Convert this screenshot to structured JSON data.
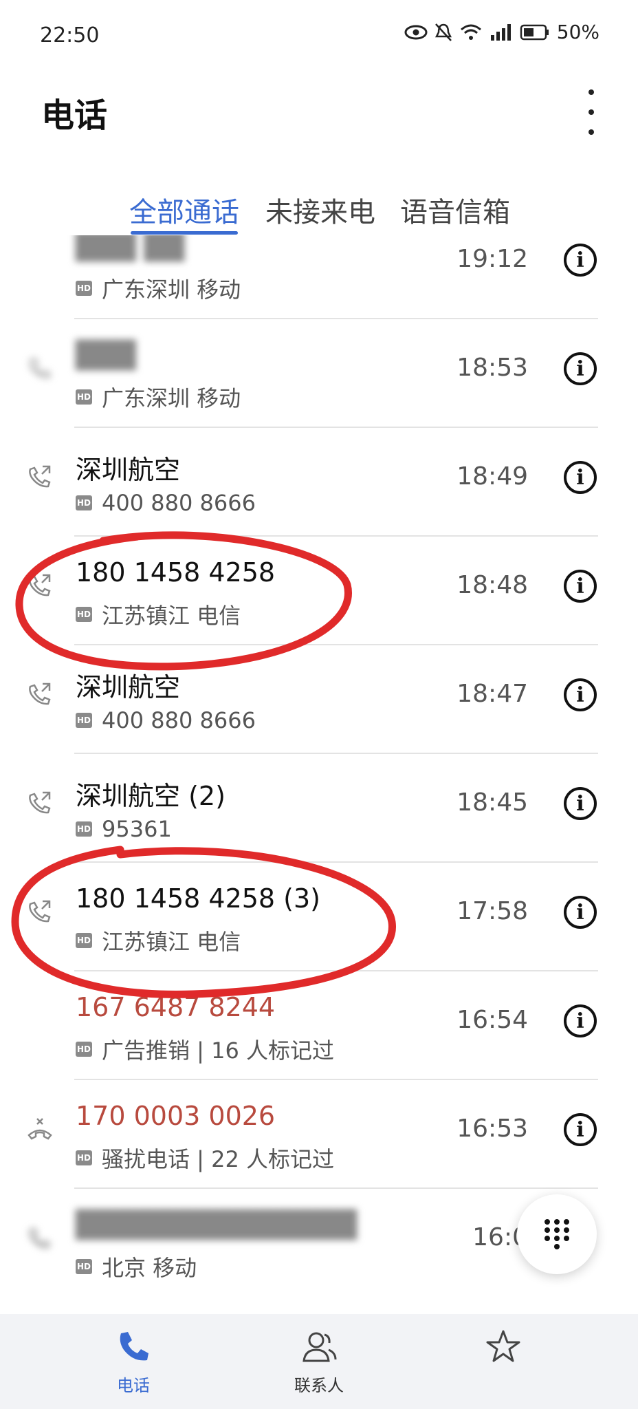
{
  "status_bar": {
    "time": "22:50",
    "battery": "50%",
    "icons": [
      "eye-icon",
      "mute-bell-icon",
      "wifi-icon",
      "signal-icon",
      "battery-icon"
    ]
  },
  "header": {
    "title": "电话"
  },
  "tabs": [
    {
      "label": "全部通话",
      "active": true
    },
    {
      "label": "未接来电",
      "active": false
    },
    {
      "label": "语音信箱",
      "active": false
    }
  ],
  "calls": [
    {
      "name": "",
      "sub": "广东深圳 移动",
      "time": "19:12",
      "spam": false,
      "blurred_name": true
    },
    {
      "name": "",
      "sub": "广东深圳 移动",
      "time": "18:53",
      "spam": false,
      "blurred_name": true
    },
    {
      "name": "深圳航空",
      "sub": "400 880 8666",
      "time": "18:49",
      "spam": false
    },
    {
      "name": "180 1458 4258",
      "sub": "江苏镇江 电信",
      "time": "18:48",
      "spam": false
    },
    {
      "name": "深圳航空",
      "sub": "400 880 8666",
      "time": "18:47",
      "spam": false
    },
    {
      "name": "深圳航空 (2)",
      "sub": "95361",
      "time": "18:45",
      "spam": false
    },
    {
      "name": "180 1458 4258 (3)",
      "sub": "江苏镇江 电信",
      "time": "17:58",
      "spam": false
    },
    {
      "name": "167 6487 8244",
      "sub": "广告推销 | 16 人标记过",
      "time": "16:54",
      "spam": true
    },
    {
      "name": "170 0003 0026",
      "sub": "骚扰电话 | 22 人标记过",
      "time": "16:53",
      "spam": true
    },
    {
      "name": "",
      "sub": "北京 移动",
      "time": "16:0",
      "spam": false,
      "blurred_name": true
    }
  ],
  "hd_label": "HD",
  "info_glyph": "i",
  "bottom_nav": [
    {
      "label": "电话",
      "active": true
    },
    {
      "label": "联系人",
      "active": false
    },
    {
      "label": "",
      "active": false
    }
  ],
  "colors": {
    "accent": "#3a6bd1",
    "spam": "#b84a3e",
    "annotation_red": "#e02a2a"
  }
}
